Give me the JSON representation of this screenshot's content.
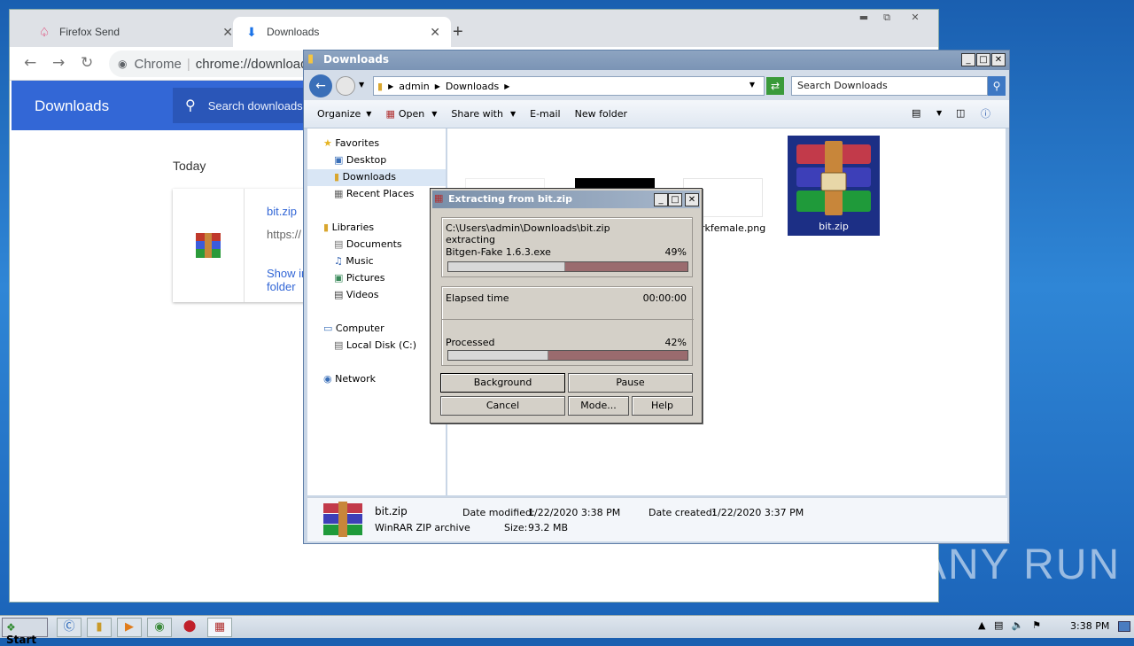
{
  "chrome": {
    "tabs": [
      {
        "label": "Firefox Send",
        "icon": "firefox-send-icon"
      },
      {
        "label": "Downloads",
        "icon": "download-icon"
      }
    ],
    "new_tab": "+",
    "omnibox_prefix": "Chrome",
    "omnibox_url": "chrome://downloads",
    "header_title": "Downloads",
    "search_placeholder": "Search downloads",
    "section": "Today",
    "download": {
      "name": "bit.zip",
      "url": "https://",
      "action": "Show in folder"
    }
  },
  "explorer": {
    "title": "Downloads",
    "breadcrumbs": [
      "admin",
      "Downloads"
    ],
    "search_placeholder": "Search Downloads",
    "toolbar": [
      "Organize",
      "Open",
      "Share with",
      "E-mail",
      "New folder"
    ],
    "tree": {
      "favorites": "Favorites",
      "desktop": "Desktop",
      "downloads": "Downloads",
      "recent": "Recent Places",
      "libraries": "Libraries",
      "documents": "Documents",
      "music": "Music",
      "pictures": "Pictures",
      "videos": "Videos",
      "computer": "Computer",
      "localdisk": "Local Disk (C:)",
      "network": "Network"
    },
    "files": [
      {
        "name": "rkfemale.png"
      },
      {
        "name": "bit.zip"
      }
    ],
    "details": {
      "name": "bit.zip",
      "type": "WinRAR ZIP archive",
      "modified_label": "Date modified:",
      "modified": "1/22/2020 3:38 PM",
      "created_label": "Date created:",
      "created": "1/22/2020 3:37 PM",
      "size_label": "Size:",
      "size": "93.2 MB"
    }
  },
  "dialog": {
    "title": "Extracting from bit.zip",
    "path": "C:\\Users\\admin\\Downloads\\bit.zip",
    "action": "extracting",
    "file": "Bitgen-Fake 1.6.3.exe",
    "file_percent": "49%",
    "file_progress": 0.49,
    "elapsed_label": "Elapsed time",
    "elapsed": "00:00:00",
    "processed_label": "Processed",
    "processed_percent": "42%",
    "processed_progress": 0.42,
    "buttons": {
      "background": "Background",
      "pause": "Pause",
      "cancel": "Cancel",
      "mode": "Mode...",
      "help": "Help"
    }
  },
  "taskbar": {
    "start": "Start",
    "clock": "3:38 PM"
  },
  "watermark": "ANY RUN"
}
